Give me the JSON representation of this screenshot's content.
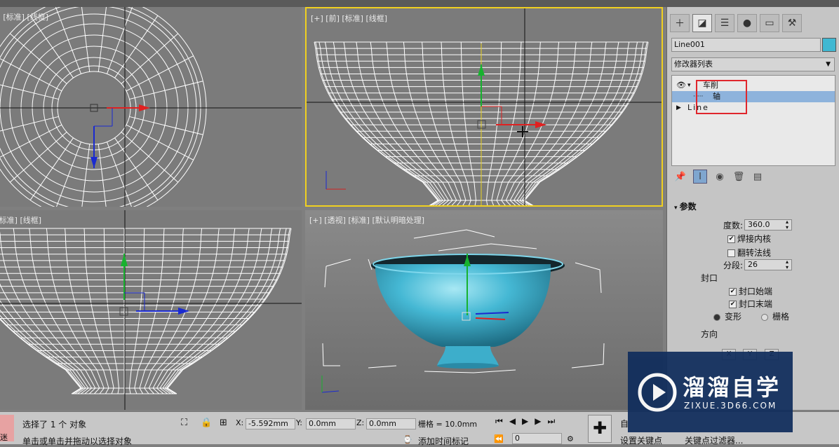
{
  "viewports": {
    "top": {
      "label": "[+] [顶] [标准] [线框]"
    },
    "front": {
      "label": "[+] [前] [标准] [线框]"
    },
    "left": {
      "label": "[+] [左] [标准] [线框]"
    },
    "perspective": {
      "label": "[+] [透视] [标准] [默认明暗处理]"
    }
  },
  "command_panel": {
    "tabs": [
      "create-icon",
      "modify-icon",
      "hierarchy-icon",
      "motion-icon",
      "display-icon",
      "utilities-icon"
    ],
    "object_name": "Line001",
    "object_color": "#40b8d2",
    "modifier_list": "修改器列表",
    "stack": {
      "lathe": "车削",
      "axis": "轴",
      "line": "Line"
    },
    "params": {
      "title": "参数",
      "degrees_label": "度数:",
      "degrees_value": "360.0",
      "weld_core": "焊接内核",
      "flip_normals": "翻转法线",
      "segments_label": "分段:",
      "segments_value": "26",
      "capping_title": "封口",
      "cap_start": "封口始端",
      "cap_end": "封口末端",
      "morph": "变形",
      "grid": "栅格",
      "direction_title": "方向",
      "axes": [
        "X",
        "Y",
        "Z"
      ]
    }
  },
  "status": {
    "prefix": "迷",
    "selected": "选择了 1 个 对象",
    "hint": "单击或单击并拖动以选择对象",
    "x_label": "X:",
    "x_value": "-5.592mm",
    "y_label": "Y:",
    "y_value": "0.0mm",
    "z_label": "Z:",
    "z_value": "0.0mm",
    "grid_label": "栅格 = 10.0mm",
    "add_time_tag": "添加时间标记",
    "frame_value": "0",
    "auto_key": "自",
    "set_key": "设置关键点",
    "key_filters": "关键点过滤器..."
  },
  "watermark": {
    "brand": "溜溜自学",
    "url": "ZIXUE.3D66.COM"
  }
}
